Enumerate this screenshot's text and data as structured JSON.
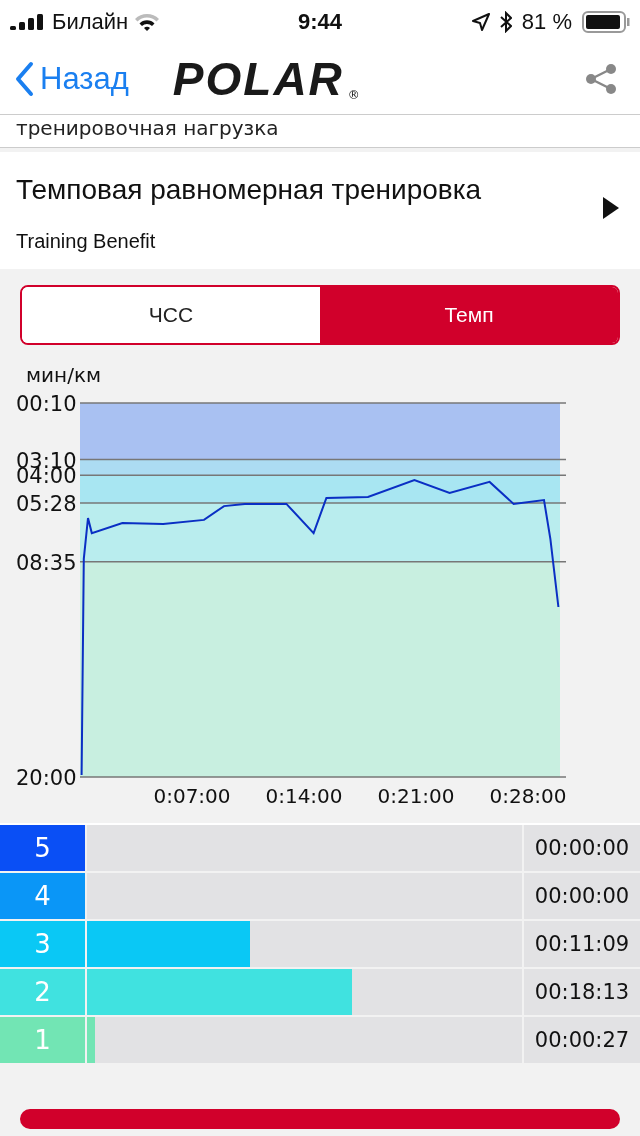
{
  "status_bar": {
    "carrier": "Билайн",
    "time": "9:44",
    "battery": "81 %"
  },
  "nav": {
    "back": "Назад",
    "logo": "POLAR",
    "logo_mark": "®"
  },
  "prev_section": "тренировочная нагрузка",
  "header": {
    "title": "Темповая равномерная тренировка",
    "subtitle": "Training Benefit"
  },
  "tabs": [
    {
      "label": "ЧСС",
      "selected": false
    },
    {
      "label": "Темп",
      "selected": true
    }
  ],
  "chart": {
    "bands": [
      {
        "color": "#a9c1f2"
      },
      {
        "color": "#acdcf2"
      },
      {
        "color": "#a8e6f2"
      },
      {
        "color": "#b9edee"
      },
      {
        "color": "#c8efe0"
      }
    ],
    "chart_data": {
      "type": "line",
      "grid": true,
      "ylabel": "мин/км",
      "xlim": [
        0,
        30
      ],
      "ylim": [
        1200,
        10
      ],
      "xticks": [
        {
          "value": 7,
          "label": "0:07:00"
        },
        {
          "value": 14,
          "label": "0:14:00"
        },
        {
          "value": 21,
          "label": "0:21:00"
        },
        {
          "value": 28,
          "label": "0:28:00"
        }
      ],
      "yticks": [
        {
          "value": 10,
          "label": "00:10"
        },
        {
          "value": 190,
          "label": "03:10"
        },
        {
          "value": 240,
          "label": "04:00"
        },
        {
          "value": 328,
          "label": "05:28"
        },
        {
          "value": 515,
          "label": "08:35"
        },
        {
          "value": 1200,
          "label": "20:00"
        }
      ],
      "x": [
        0.1,
        0.24,
        0.5,
        0.74,
        2.65,
        5.2,
        7.75,
        9.0,
        10.3,
        12.9,
        14.6,
        15.4,
        18.0,
        20.9,
        23.1,
        25.6,
        27.1,
        29.0,
        29.4,
        29.9
      ],
      "series": [
        {
          "color": "#0a2fc4",
          "values": [
            1194,
            506,
            376,
            424,
            392,
            395,
            382,
            338,
            331,
            331,
            424,
            312,
            309,
            255,
            296,
            261,
            331,
            319,
            443,
            659
          ]
        }
      ]
    }
  },
  "zones": [
    {
      "label": "5",
      "color": "#0a4ff5",
      "level": 0,
      "time": "00:00:00"
    },
    {
      "label": "4",
      "color": "#0a96f7",
      "level": 0,
      "time": "00:00:00"
    },
    {
      "label": "3",
      "color": "#0ac8f5",
      "level": 0.374,
      "time": "00:11:09"
    },
    {
      "label": "2",
      "color": "#40e2e0",
      "level": 0.61,
      "time": "00:18:13"
    },
    {
      "label": "1",
      "color": "#72e5b4",
      "level": 0.018,
      "time": "00:00:27"
    }
  ]
}
